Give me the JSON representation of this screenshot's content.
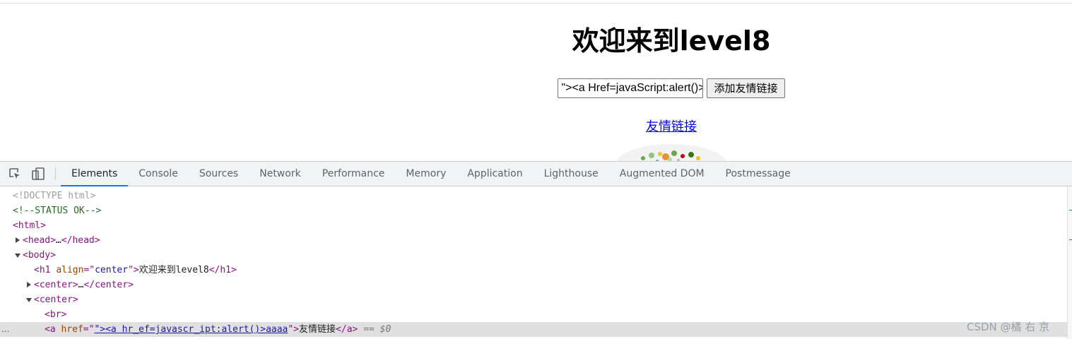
{
  "page": {
    "heading": "欢迎来到level8",
    "input_value": "\"><a Href=javaScript:alert()>aaaa",
    "add_button_label": "添加友情链接",
    "friend_link_text": "友情链接"
  },
  "devtools": {
    "tabs": [
      "Elements",
      "Console",
      "Sources",
      "Network",
      "Performance",
      "Memory",
      "Application",
      "Lighthouse",
      "Augmented DOM",
      "Postmessage"
    ],
    "active_tab": "Elements",
    "dom": {
      "doctype": "<!DOCTYPE html>",
      "comment": "<!--STATUS OK-->",
      "html_open": "<html>",
      "head_open": "<head>",
      "head_ellipsis": "…",
      "head_close": "</head>",
      "body_open": "<body>",
      "h1_open": "<h1",
      "h1_attr_name": "align",
      "h1_attr_eq": "=\"",
      "h1_attr_value": "center",
      "h1_attr_end": "\">",
      "h1_text": "欢迎来到level8",
      "h1_close": "</h1>",
      "center_open": "<center>",
      "center_ellipsis": "…",
      "center_close": "</center>",
      "br_tag": "<br>",
      "a_open": "<a",
      "a_attr_name": "href",
      "a_attr_eq": "=\"",
      "a_href_value": "\"><a hr_ef=javascr_ipt:alert()>aaaa",
      "a_attr_end": "\">",
      "a_text": "友情链接",
      "a_close": "</a>",
      "selected_marker": "== $0",
      "more_dots": "..."
    }
  },
  "watermark": "CSDN @橘 右 京"
}
